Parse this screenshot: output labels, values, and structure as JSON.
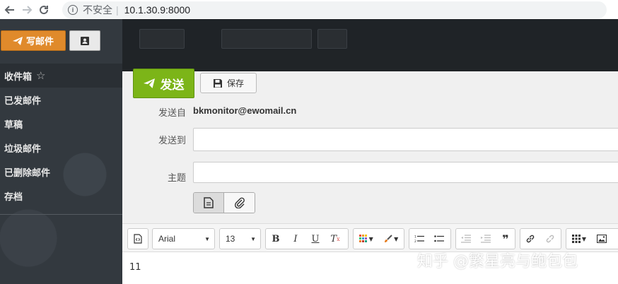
{
  "browser": {
    "insecure_label": "不安全",
    "url": "10.1.30.9:8000"
  },
  "sidebar": {
    "compose_label": "写邮件",
    "folders": [
      {
        "label": "收件箱"
      },
      {
        "label": "已发邮件"
      },
      {
        "label": "草稿"
      },
      {
        "label": "垃圾邮件"
      },
      {
        "label": "已删除邮件"
      },
      {
        "label": "存档"
      }
    ]
  },
  "compose": {
    "send_label": "发送",
    "save_label": "保存",
    "from_label": "发送自",
    "from_value": "bkmonitor@ewomail.cn",
    "to_label": "发送到",
    "to_value": "",
    "subject_label": "主题",
    "subject_value": ""
  },
  "editor": {
    "font_family": "Arial",
    "font_size": "13",
    "body_text": "11"
  },
  "watermark": "知乎 @繁星亮与鲍包包",
  "colors": {
    "compose_button": "#e08a2b",
    "send_button": "#7cb518",
    "sidebar_bg": "#33393f"
  }
}
